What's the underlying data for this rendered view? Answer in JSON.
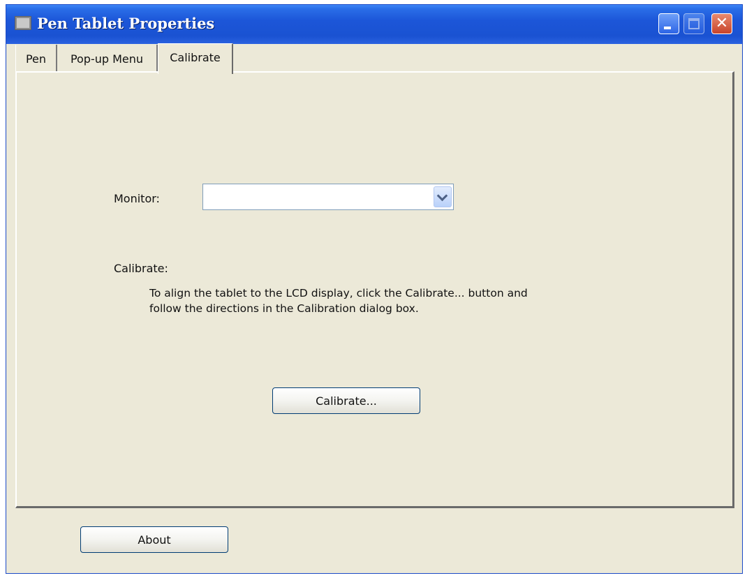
{
  "window": {
    "title": "Pen Tablet Properties",
    "icons": {
      "app": "tablet-app-icon",
      "minimize": "minimize-icon",
      "maximize": "maximize-icon",
      "close": "close-icon"
    },
    "close_glyph": "✕",
    "colors": {
      "titlebar": "#1c56d8",
      "face": "#ece9d8",
      "close_button": "#c8442a"
    }
  },
  "tabs": [
    {
      "label": "Pen",
      "selected": false
    },
    {
      "label": "Pop-up Menu",
      "selected": false
    },
    {
      "label": "Calibrate",
      "selected": true
    }
  ],
  "calibrate_tab": {
    "monitor_label": "Monitor:",
    "monitor_value": "",
    "calibrate_heading": "Calibrate:",
    "description_lines": [
      "To align the tablet to the LCD display, click the Calibrate... button and",
      "follow the directions in the Calibration dialog box."
    ],
    "calibrate_button": "Calibrate..."
  },
  "footer": {
    "about_button": "About"
  }
}
